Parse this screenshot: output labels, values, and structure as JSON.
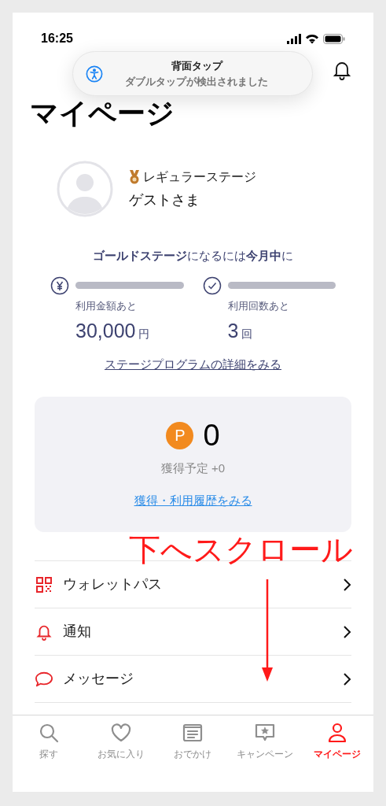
{
  "status_bar": {
    "time": "16:25"
  },
  "toast": {
    "title": "背面タップ",
    "message": "ダブルタップが検出されました"
  },
  "header": {
    "title": "マイページ"
  },
  "profile": {
    "stage": "レギュラーステージ",
    "name": "ゲストさま"
  },
  "stage_goal": {
    "headline": "**ゴールドステージ**になるには**今月中**に",
    "metrics": [
      {
        "kind": "yen",
        "label": "利用金額あと",
        "value": "30,000",
        "unit": "円",
        "level": 0
      },
      {
        "kind": "check",
        "label": "利用回数あと",
        "value": "3",
        "unit": "回",
        "level": 0
      }
    ],
    "link": "ステージプログラムの詳細をみる"
  },
  "points": {
    "badge": "P",
    "balance": "0",
    "pending": "獲得予定 +0",
    "link": "獲得・利用履歴をみる"
  },
  "annotation": {
    "text": "下へスクロール"
  },
  "menu": [
    {
      "kind": "qr",
      "label": "ウォレットパス"
    },
    {
      "kind": "bell",
      "label": "通知"
    },
    {
      "kind": "chat",
      "label": "メッセージ"
    }
  ],
  "tab_bar": [
    {
      "kind": "search",
      "label": "探す",
      "selected": false
    },
    {
      "kind": "heart",
      "label": "お気に入り",
      "selected": false
    },
    {
      "kind": "calendar",
      "label": "おでかけ",
      "selected": false
    },
    {
      "kind": "star",
      "label": "キャンペーン",
      "selected": false
    },
    {
      "kind": "person",
      "label": "マイページ",
      "selected": true
    }
  ]
}
